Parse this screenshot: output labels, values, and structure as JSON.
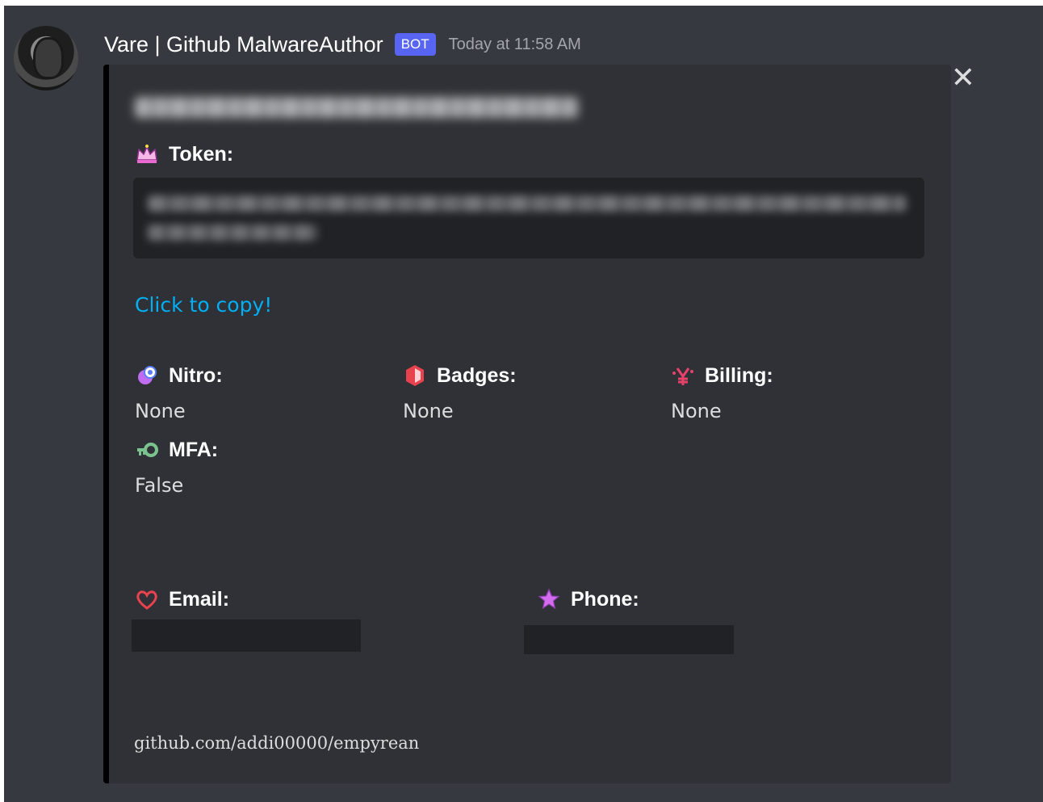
{
  "message": {
    "author": "Vare | Github MalwareAuthor",
    "bot_tag": "BOT",
    "timestamp": "Today at 11:58 AM"
  },
  "embed": {
    "token_field_name": "Token:",
    "copy_link": "Click to copy!",
    "fields": [
      {
        "name": "Nitro:",
        "value": "None",
        "icon": "nitro-icon"
      },
      {
        "name": "Badges:",
        "value": "None",
        "icon": "badge-icon"
      },
      {
        "name": "Billing:",
        "value": "None",
        "icon": "billing-icon"
      },
      {
        "name": "MFA:",
        "value": "False",
        "icon": "key-icon"
      }
    ],
    "email_field_name": "Email:",
    "phone_field_name": "Phone:",
    "footer": "github.com/addi00000/empyrean"
  },
  "colors": {
    "background": "#36393f",
    "embed_bg": "#2f3136",
    "embed_border": "#000000",
    "link": "#00aff4",
    "bot_tag": "#5865f2",
    "redaction": "#202225"
  }
}
